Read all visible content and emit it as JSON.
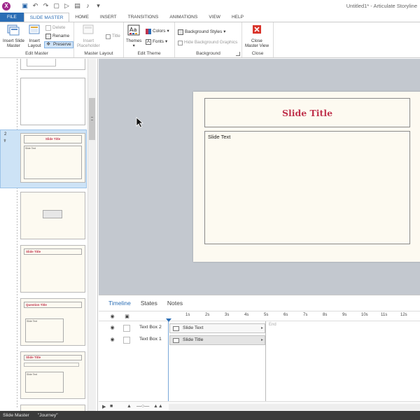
{
  "window": {
    "title": "Untitled1* - Articulate Storyline",
    "logo_letter": "X"
  },
  "ribbon_tabs": [
    "FILE",
    "SLIDE MASTER",
    "HOME",
    "INSERT",
    "TRANSITIONS",
    "ANIMATIONS",
    "VIEW",
    "HELP"
  ],
  "ribbon": {
    "edit_master": {
      "label": "Edit Master",
      "insert_slide_master_l1": "Insert Slide",
      "insert_slide_master_l2": "Master",
      "insert_layout_l1": "Insert",
      "insert_layout_l2": "Layout",
      "delete": "Delete",
      "rename": "Rename",
      "preserve": "Preserve"
    },
    "master_layout": {
      "label": "Master Layout",
      "insert_placeholder_l1": "Insert",
      "insert_placeholder_l2": "Placeholder",
      "title": "Title"
    },
    "edit_theme": {
      "label": "Edit Theme",
      "themes": "Themes",
      "colors": "Colors",
      "fonts": "Fonts"
    },
    "background": {
      "label": "Background",
      "background_styles": "Background Styles",
      "hide_background_graphics": "Hide Background Graphics"
    },
    "close": {
      "label": "Close",
      "close_master_view_l1": "Close",
      "close_master_view_l2": "Master View"
    }
  },
  "slide_panel": {
    "selected_number": "2",
    "thumb_title_text": "Slide Title",
    "thumb_body_text": "Slide Text",
    "thumb_question_title": "Question Title"
  },
  "slide": {
    "title": "Slide Title",
    "body": "Slide Text"
  },
  "timeline": {
    "tabs": [
      "Timeline",
      "States",
      "Notes"
    ],
    "ruler": [
      "1s",
      "2s",
      "3s",
      "4s",
      "5s",
      "6s",
      "7s",
      "8s",
      "9s",
      "10s",
      "11s",
      "12s"
    ],
    "end_label": "End",
    "rows": [
      {
        "name": "Text Box 2",
        "bar_label": "Slide Text"
      },
      {
        "name": "Text Box 1",
        "bar_label": "Slide Title"
      }
    ]
  },
  "status_bar": {
    "view": "Slide Master",
    "theme": "\"Journey\""
  },
  "colors": {
    "accent": "#2a6db5",
    "title_red": "#c0334d",
    "slide_bg": "#fdfaf1",
    "canvas_bg": "#c3c8cf"
  }
}
